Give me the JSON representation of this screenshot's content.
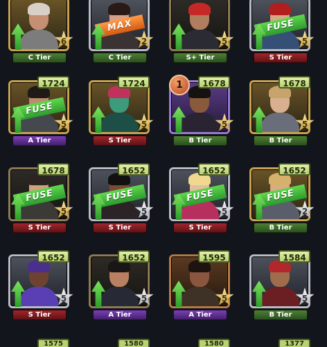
{
  "colors": {
    "background": "#12151b",
    "power_bg": "#c8df86",
    "fuse_green": "#46bd3d",
    "max_orange": "#ef7a2f"
  },
  "cards": [
    {
      "tier": "C Tier",
      "tier_color": "green",
      "stars": 6,
      "star_type": "gold",
      "frame": "gold",
      "banner": "",
      "power": "",
      "badge": ""
    },
    {
      "tier": "C Tier",
      "tier_color": "green",
      "stars": 2,
      "star_type": "gold",
      "frame": "silver",
      "banner": "MAX",
      "power": "",
      "badge": ""
    },
    {
      "tier": "S+ Tier",
      "tier_color": "green",
      "stars": 5,
      "star_type": "gold",
      "frame": "dark",
      "banner": "",
      "power": "",
      "badge": ""
    },
    {
      "tier": "S Tier",
      "tier_color": "red",
      "stars": 5,
      "star_type": "gold",
      "frame": "silver",
      "banner": "FUSE",
      "power": "",
      "badge": ""
    },
    {
      "tier": "A Tier",
      "tier_color": "purple",
      "stars": 5,
      "star_type": "gold",
      "frame": "gold",
      "banner": "FUSE",
      "power": "1724",
      "badge": ""
    },
    {
      "tier": "S Tier",
      "tier_color": "red",
      "stars": 5,
      "star_type": "gold",
      "frame": "gold",
      "banner": "",
      "power": "1724",
      "badge": ""
    },
    {
      "tier": "B Tier",
      "tier_color": "green",
      "stars": 5,
      "star_type": "gold",
      "frame": "purple",
      "banner": "",
      "power": "1678",
      "badge": "1"
    },
    {
      "tier": "B Tier",
      "tier_color": "green",
      "stars": 5,
      "star_type": "gold",
      "frame": "gold",
      "banner": "",
      "power": "1678",
      "badge": ""
    },
    {
      "tier": "S Tier",
      "tier_color": "red",
      "stars": 5,
      "star_type": "gold",
      "frame": "dark",
      "banner": "FUSE",
      "power": "1678",
      "badge": ""
    },
    {
      "tier": "S Tier",
      "tier_color": "red",
      "stars": 5,
      "star_type": "silver",
      "frame": "silver",
      "banner": "FUSE",
      "power": "1652",
      "badge": ""
    },
    {
      "tier": "S Tier",
      "tier_color": "red",
      "stars": 5,
      "star_type": "silver",
      "frame": "silver",
      "banner": "FUSE",
      "power": "1652",
      "badge": ""
    },
    {
      "tier": "B Tier",
      "tier_color": "green",
      "stars": 2,
      "star_type": "silver",
      "frame": "gold",
      "banner": "FUSE",
      "power": "1652",
      "badge": ""
    },
    {
      "tier": "S Tier",
      "tier_color": "red",
      "stars": 5,
      "star_type": "silver",
      "frame": "silver",
      "banner": "",
      "power": "1652",
      "badge": ""
    },
    {
      "tier": "A Tier",
      "tier_color": "purple",
      "stars": 5,
      "star_type": "silver",
      "frame": "dark",
      "banner": "",
      "power": "1652",
      "badge": ""
    },
    {
      "tier": "A Tier",
      "tier_color": "purple",
      "stars": 5,
      "star_type": "gold",
      "frame": "bronze",
      "banner": "",
      "power": "1595",
      "badge": ""
    },
    {
      "tier": "B Tier",
      "tier_color": "green",
      "stars": 5,
      "star_type": "silver",
      "frame": "silver",
      "banner": "",
      "power": "1584",
      "badge": ""
    }
  ],
  "bottom_row_powers": [
    "1575",
    "1580",
    "1580",
    "1377"
  ],
  "avatars": [
    {
      "skin": "#c58f73",
      "hair": "#d8d0c7",
      "shirt": "#7c7c7c"
    },
    {
      "skin": "#d6a088",
      "hair": "#2a1a16",
      "shirt": "#3b3233"
    },
    {
      "skin": "#b07d5e",
      "hair": "#c62828",
      "shirt": "#2b2b33"
    },
    {
      "skin": "#d5a783",
      "hair": "#b21d1d",
      "shirt": "#364f76"
    },
    {
      "skin": "#ba8b6d",
      "hair": "#1f1a18",
      "shirt": "#45494f"
    },
    {
      "skin": "#3d9a7b",
      "hair": "#c2315b",
      "shirt": "#1e4f46"
    },
    {
      "skin": "#8a5a3c",
      "hair": "#161211",
      "shirt": "#2a2432"
    },
    {
      "skin": "#d8b090",
      "hair": "#c7a46c",
      "shirt": "#6a6e7a"
    },
    {
      "skin": "#d1a07e",
      "hair": "#2c2420",
      "shirt": "#3c3a37"
    },
    {
      "skin": "#7b4a33",
      "hair": "#111",
      "shirt": "#2b2325"
    },
    {
      "skin": "#e3be9e",
      "hair": "#f1d88f",
      "shirt": "#b62f5d"
    },
    {
      "skin": "#d9ab86",
      "hair": "#d6b16c",
      "shirt": "#5a5e6b"
    },
    {
      "skin": "#6e4230",
      "hair": "#4b2f8f",
      "shirt": "#5a3fb4"
    },
    {
      "skin": "#b88060",
      "hair": "#1b1616",
      "shirt": "#272a34"
    },
    {
      "skin": "#8a5640",
      "hair": "#1d1412",
      "shirt": "#3e3125"
    },
    {
      "skin": "#a06c4e",
      "hair": "#b2262c",
      "shirt": "#6b1f23"
    }
  ]
}
